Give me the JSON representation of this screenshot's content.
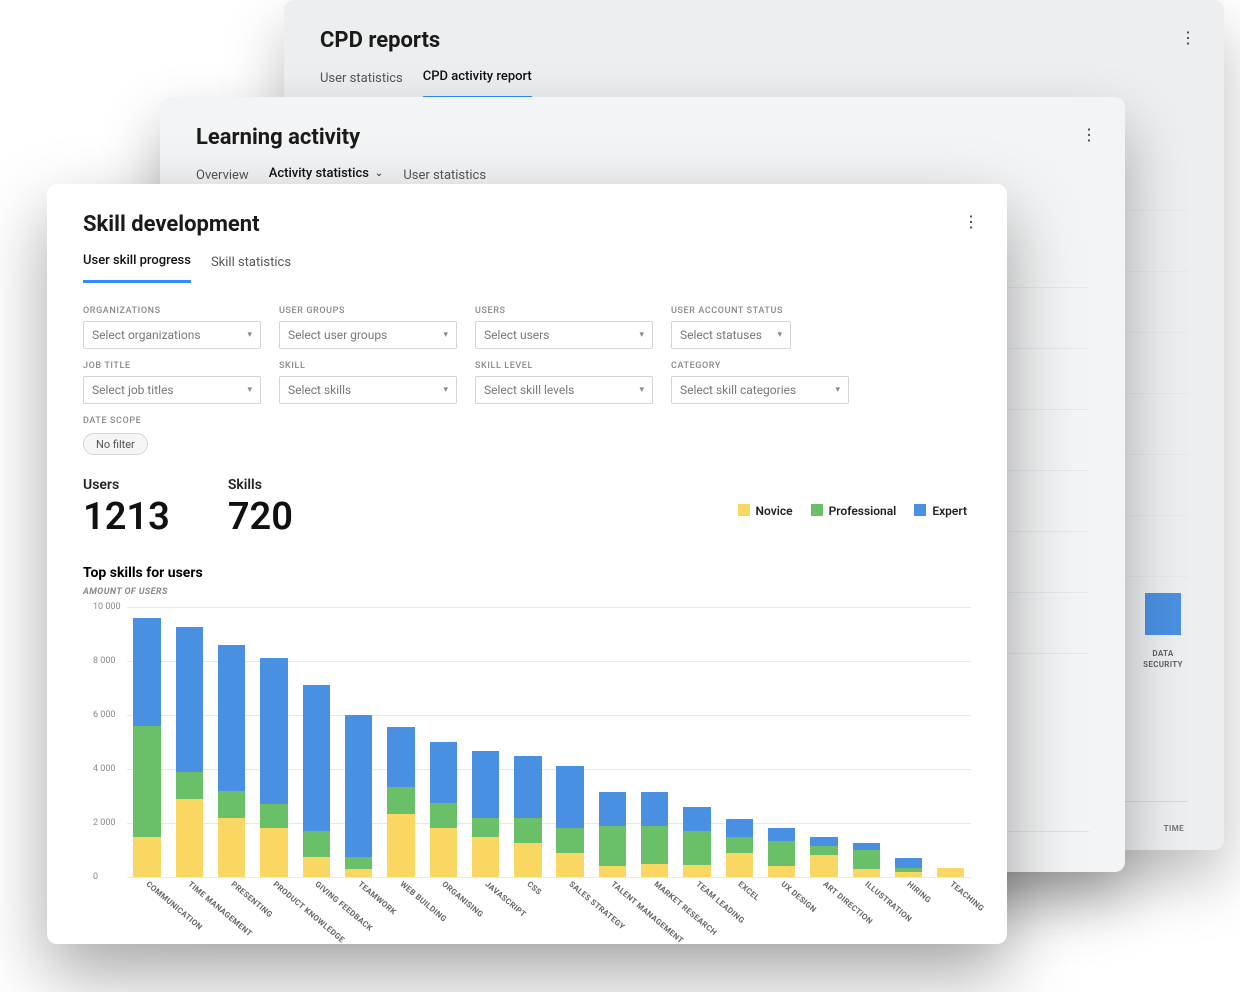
{
  "colors": {
    "novice": "#f9d762",
    "professional": "#6abf69",
    "expert": "#4a90e2"
  },
  "panels": {
    "back": {
      "title": "CPD reports",
      "tabs": [
        "User statistics",
        "CPD activity report"
      ],
      "active_tab": "CPD activity report",
      "mini_bar_label": "DATA SECURITY",
      "xaxis": "time"
    },
    "mid": {
      "title": "Learning activity",
      "tabs": [
        "Overview",
        "Activity statistics",
        "User statistics"
      ],
      "active_tab": "Activity statistics"
    },
    "front": {
      "title": "Skill development",
      "tabs": [
        "User skill progress",
        "Skill statistics"
      ],
      "active_tab": "User skill progress",
      "filters": [
        {
          "label": "Organizations",
          "placeholder": "Select organizations"
        },
        {
          "label": "User groups",
          "placeholder": "Select user groups"
        },
        {
          "label": "Users",
          "placeholder": "Select users"
        },
        {
          "label": "User account status",
          "placeholder": "Select statuses",
          "narrow": true
        },
        {
          "label": "Job title",
          "placeholder": "Select job titles"
        },
        {
          "label": "Skill",
          "placeholder": "Select skills"
        },
        {
          "label": "Skill level",
          "placeholder": "Select skill levels"
        },
        {
          "label": "Category",
          "placeholder": "Select skill categories"
        }
      ],
      "date_scope": {
        "label": "Date scope",
        "pill": "No filter"
      },
      "stats": [
        {
          "label": "Users",
          "value": "1213"
        },
        {
          "label": "Skills",
          "value": "720"
        }
      ],
      "chart_title": "Top skills for users",
      "yaxis_label": "Amount of users",
      "legend": [
        "Novice",
        "Professional",
        "Expert"
      ]
    }
  },
  "chart_data": {
    "type": "bar",
    "stacked": true,
    "ylabel": "Amount of users",
    "ylim": [
      0,
      10000
    ],
    "yticks": [
      0,
      2000,
      4000,
      6000,
      8000,
      10000
    ],
    "ytick_labels": [
      "0",
      "2 000",
      "4 000",
      "6 000",
      "8 000",
      "10 000"
    ],
    "legend_position": "top-right",
    "categories": [
      "Communication",
      "Time Management",
      "Presenting",
      "Product Knowledge",
      "Giving Feedback",
      "Teamwork",
      "Web Building",
      "Organising",
      "JavaScript",
      "CSS",
      "Sales Strategy",
      "Talent Management",
      "Market Research",
      "Team Leading",
      "Excel",
      "UX Design",
      "Art Direction",
      "Illustration",
      "Hiring",
      "Teaching"
    ],
    "series": [
      {
        "name": "Novice",
        "values": [
          1500,
          2900,
          2200,
          1800,
          750,
          300,
          2350,
          1800,
          1500,
          1250,
          900,
          400,
          500,
          450,
          900,
          400,
          800,
          300,
          200,
          350
        ]
      },
      {
        "name": "Professional",
        "values": [
          4100,
          1000,
          1000,
          900,
          950,
          450,
          1000,
          950,
          700,
          950,
          900,
          1500,
          1400,
          1250,
          600,
          950,
          350,
          700,
          150,
          0
        ]
      },
      {
        "name": "Expert",
        "values": [
          4000,
          5350,
          5400,
          5400,
          5400,
          5250,
          2200,
          2250,
          2450,
          2300,
          2300,
          1250,
          1250,
          900,
          650,
          450,
          350,
          250,
          350,
          0
        ]
      }
    ]
  }
}
